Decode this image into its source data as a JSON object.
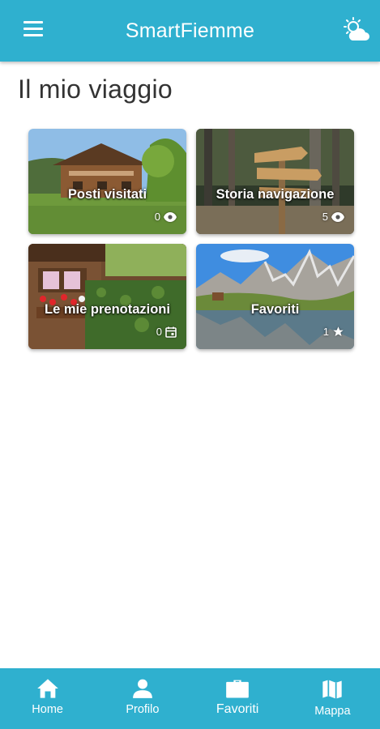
{
  "app": {
    "title": "SmartFiemme"
  },
  "page": {
    "title": "Il mio viaggio"
  },
  "cards": [
    {
      "label": "Posti visitati",
      "count": "0",
      "icon": "eye-icon"
    },
    {
      "label": "Storia navigazione",
      "count": "5",
      "icon": "eye-icon"
    },
    {
      "label": "Le mie prenotazioni",
      "count": "0",
      "icon": "calendar-icon"
    },
    {
      "label": "Favoriti",
      "count": "1",
      "icon": "star-icon"
    }
  ],
  "nav": [
    {
      "label": "Home",
      "icon": "home-icon"
    },
    {
      "label": "Profilo",
      "icon": "person-icon"
    },
    {
      "label": "Favoriti",
      "icon": "briefcase-icon",
      "active": true
    },
    {
      "label": "Mappa",
      "icon": "map-icon"
    }
  ],
  "colors": {
    "primary": "#2fb0cf",
    "text": "#333333"
  }
}
